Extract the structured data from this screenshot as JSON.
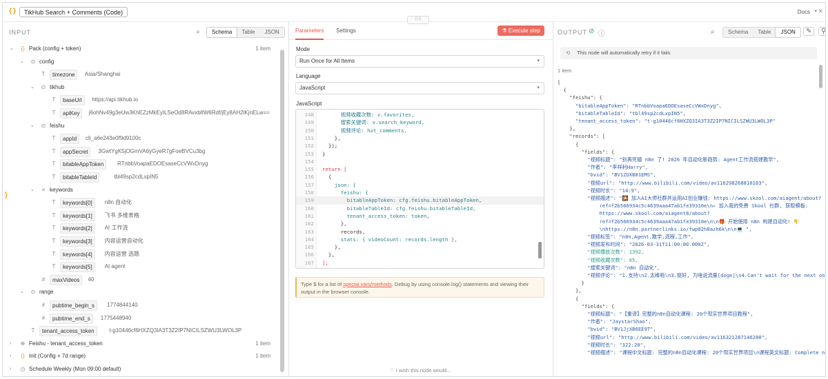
{
  "header": {
    "title": "TikHub Search + Comments (Code)",
    "docs": "Docs",
    "node_icon": "{}"
  },
  "input": {
    "label": "INPUT",
    "view_tabs": [
      "Schema",
      "Table",
      "JSON"
    ],
    "active_tab": "Schema",
    "tree": [
      {
        "depth": 0,
        "caret": "down",
        "icon": "{}",
        "key": "Pack (config + token)",
        "count": "1 item",
        "boxed": false
      },
      {
        "depth": 1,
        "caret": "down",
        "icon": "⊙",
        "key": "config",
        "boxed": false
      },
      {
        "depth": 2,
        "caret": "",
        "icon": "T",
        "key": "timezone",
        "val": "Asia/Shanghai",
        "boxed": true
      },
      {
        "depth": 2,
        "caret": "down",
        "icon": "⊙",
        "key": "tikhub",
        "boxed": false
      },
      {
        "depth": 3,
        "caret": "",
        "icon": "T",
        "key": "baseUrl",
        "val": "https://api.tikhub.io",
        "boxed": true
      },
      {
        "depth": 3,
        "caret": "",
        "icon": "T",
        "key": "apiKey",
        "val": "j6ohNv49g3eUw3KhEZzMkEyILSeOd8RAvxbltW6Rdf/jEy8AH2lKjnELw==",
        "boxed": true
      },
      {
        "depth": 2,
        "caret": "down",
        "icon": "⊙",
        "key": "feishu",
        "boxed": false
      },
      {
        "depth": 3,
        "caret": "",
        "icon": "T",
        "key": "appId",
        "val": "cli_a6e243e0f9d9100c",
        "boxed": true
      },
      {
        "depth": 3,
        "caret": "",
        "icon": "T",
        "key": "appSecret",
        "val": "3GwtYgK5jOGmVA6yGyeR7gFoeBVCu3bg",
        "boxed": true
      },
      {
        "depth": 3,
        "caret": "",
        "icon": "T",
        "key": "bitableAppToken",
        "val": "RTnbbVoapaEDOEsaseCcVWxDnyg",
        "boxed": true
      },
      {
        "depth": 3,
        "caret": "",
        "icon": "T",
        "key": "bitableTableId",
        "val": "tbl49sp2cdLxpIN5",
        "boxed": true
      },
      {
        "depth": 2,
        "caret": "down",
        "icon": "≡",
        "key": "keywords",
        "boxed": false
      },
      {
        "depth": 3,
        "caret": "",
        "icon": "T",
        "key": "keywords[0]",
        "val": "n8n 自动化",
        "boxed": true
      },
      {
        "depth": 3,
        "caret": "",
        "icon": "T",
        "key": "keywords[1]",
        "val": "飞书 多维表格",
        "boxed": true
      },
      {
        "depth": 3,
        "caret": "",
        "icon": "T",
        "key": "keywords[2]",
        "val": "AI 工作流",
        "boxed": true
      },
      {
        "depth": 3,
        "caret": "",
        "icon": "T",
        "key": "keywords[3]",
        "val": "内容运营自动化",
        "boxed": true
      },
      {
        "depth": 3,
        "caret": "",
        "icon": "T",
        "key": "keywords[4]",
        "val": "内容运营 选题",
        "boxed": true
      },
      {
        "depth": 3,
        "caret": "",
        "icon": "T",
        "key": "keywords[5]",
        "val": "AI agent",
        "boxed": true
      },
      {
        "depth": 2,
        "caret": "",
        "icon": "#",
        "key": "maxVideos",
        "val": "40",
        "boxed": true
      },
      {
        "depth": 1,
        "caret": "down",
        "icon": "⊙",
        "key": "range",
        "boxed": false
      },
      {
        "depth": 2,
        "caret": "",
        "icon": "#",
        "key": "pubtime_begin_s",
        "val": "1774844140",
        "boxed": true
      },
      {
        "depth": 2,
        "caret": "",
        "icon": "#",
        "key": "pubtime_end_s",
        "val": "1775448940",
        "boxed": true
      },
      {
        "depth": 1,
        "caret": "",
        "icon": "T",
        "key": "tenant_access_token",
        "val": "t-g10446cf6HXZQ3IA3T3Z2IP7NICILSZWU3LWOL3P",
        "boxed": true
      },
      {
        "depth": 0,
        "caret": "right",
        "icon": "⊕",
        "key": "Feishu - tenant_access_token",
        "count": "1 item",
        "boxed": false
      },
      {
        "depth": 0,
        "caret": "right",
        "icon": "{}",
        "key": "Init (Config + 7d range)",
        "count": "1 item",
        "boxed": false
      },
      {
        "depth": 0,
        "caret": "right",
        "icon": "◷",
        "key": "Schedule Weekly (Mon 09:00 default)",
        "boxed": false
      }
    ]
  },
  "params": {
    "tabs": [
      "Parameters",
      "Settings"
    ],
    "active_tab": "Parameters",
    "execute": "Execute step",
    "mode_label": "Mode",
    "mode_value": "Run Once for All Items",
    "language_label": "Language",
    "language_value": "JavaScript",
    "code_label": "JavaScript",
    "code_lines": [
      {
        "n": "148",
        "t": "      视频收藏次数: v.favorites,"
      },
      {
        "n": "149",
        "t": "      搜索关键词: v.search_keyword,"
      },
      {
        "n": "150",
        "t": "      视频评论: hot_comments,"
      },
      {
        "n": "151",
        "t": "    },"
      },
      {
        "n": "152",
        "t": "  });"
      },
      {
        "n": "153",
        "t": "}"
      },
      {
        "n": "154",
        "t": ""
      },
      {
        "n": "155",
        "t": "return ["
      },
      {
        "n": "156",
        "t": "  {"
      },
      {
        "n": "157",
        "t": "    json: {"
      },
      {
        "n": "158",
        "t": "      feishu: {"
      },
      {
        "n": "159",
        "t": "        bitableAppToken: cfg.feishu.bitableAppToken,"
      },
      {
        "n": "160",
        "t": "        bitableTableId: cfg.feishu.bitableTableId,"
      },
      {
        "n": "161",
        "t": "        tenant_access_token: token,"
      },
      {
        "n": "162",
        "t": "      },"
      },
      {
        "n": "163",
        "t": "      records,"
      },
      {
        "n": "164",
        "t": "      stats: { videoCount: records.length },"
      },
      {
        "n": "165",
        "t": "    },"
      },
      {
        "n": "166",
        "t": "  },"
      },
      {
        "n": "167",
        "t": "];"
      }
    ],
    "hint_pre": "Type $ for a list of ",
    "hint_link": "special vars/methods",
    "hint_post": ". Debug by using console.log() statements and viewing their output in the browser console.",
    "wish": "I wish this node would..."
  },
  "output": {
    "label": "OUTPUT",
    "view_tabs": [
      "Schema",
      "Table",
      "JSON"
    ],
    "active_tab": "JSON",
    "retry": "This node will automatically retry if it fails",
    "items": "1 item",
    "json_lines": [
      "[",
      "  {",
      "    \"feishu\": {",
      "      \"bitableAppToken\": \"RTnbbVoapaEDOEsaseCcVWxDnyg\",",
      "      \"bitableTableId\": \"tbl49sp2cdLxpIN5\",",
      "      \"tenant_access_token\": \"t-g10446cf6HXZQ3IA3T3Z2IP7NICILSZWU3LWOL3P\"",
      "    },",
      "    \"records\": [",
      "      {",
      "        \"fields\": {",
      "          \"视频标题\": \"别再死磕 n8n 了! 2026 年自动化新趋势: Agent工作流搭建教学\",",
      "          \"作者\": \"李祥利Harry\",",
      "          \"bvid\": \"BV1ZUXB81EMS\",",
      "          \"视频url\": \"http://www.bilibili.com/video/av116298268810103\",",
      "          \"视频时长\": \"14:9\",",
      "          \"视频描述\": \"🎇 加入AI大师社群并运用AI创业赚钱: https://www.skool.com/aiagent/about?",
      "              ref=f2b566934c5c4639aaa47ab1fe39310e\\n✍ 加入我的免费 Skool 社群, 获取模板:",
      "              https://www.skool.com/aiagent8/about?",
      "              ref=f2b566934c5c4639aaa47ab1fe39310e\\n\\n🎁 开始使用 n8n 构建自动化! 👇",
      "              \\nhttps://n8n.partnerlinks.io/fwp82h8azh6k\\n\\n💻 \",",
      "          \"视频标签\": \"n8n,Agent,教学,流程,工作\",",
      "          \"视频发布时间\": \"2026-03-31T11:00:00.000Z\",",
      "          \"视频播放次数\": 1392,",
      "          \"视频收藏次数\": 65,",
      "          \"搜索关键词\": \"n8n 自动化\",",
      "          \"视频评论\": \"1.支持\\n2.太棒啦\\n3.挺好, 为啥说流量[doge]\\n4.Can't wait for the next one!\"",
      "        }",
      "      },",
      "      {",
      "        \"fields\": {",
      "          \"视频标题\": \"【重译】完整的n8n自动化课程: 20个现实世界项目教程\",",
      "          \"作者\": \"JaystarShao\",",
      "          \"bvid\": \"BV1JjXB6EE9T\",",
      "          \"视频url\": \"http://www.bilibili.com/video/av116321287146280\",",
      "          \"视频时长\": \"322:20\",",
      "          \"视频描述\": \"课程中文标题: 完整的n8n自动化课程: 20个现实世界项目\\n课程英文标题: Complete n8n"
    ]
  }
}
